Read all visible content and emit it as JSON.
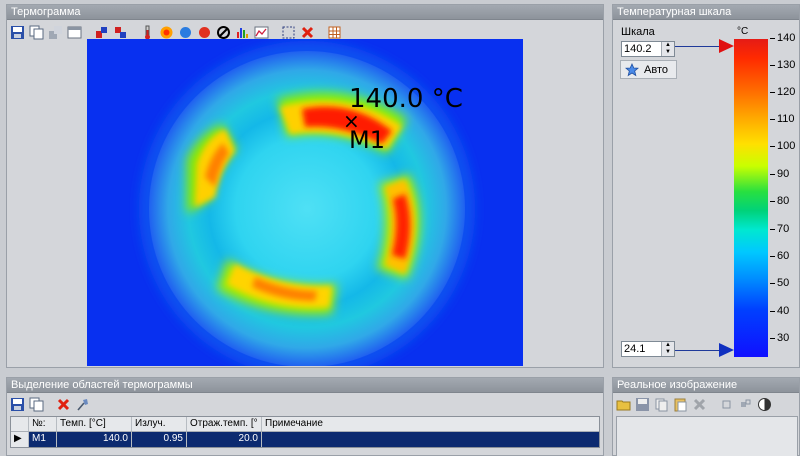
{
  "thermogram": {
    "title": "Термограмма",
    "marker": {
      "symbol": "×",
      "temperature": "140.0 °C",
      "name": "M1"
    }
  },
  "scale": {
    "title": "Температурная шкала",
    "label": "Шкала",
    "max_value": "140.2",
    "min_value": "24.1",
    "auto_label": "Авто",
    "unit": "°C",
    "ticks": [
      "140",
      "130",
      "120",
      "110",
      "100",
      "90",
      "80",
      "70",
      "60",
      "50",
      "40",
      "30"
    ]
  },
  "regions": {
    "title": "Выделение областей термограммы",
    "columns": [
      "",
      "№:",
      "Темп. [°C]",
      "Излуч.",
      "Отраж.темп. [°",
      "Примечание"
    ],
    "rows": [
      {
        "indicator": "▶",
        "id": "M1",
        "temp": "140.0",
        "emissivity": "0.95",
        "refl_temp": "20.0",
        "note": ""
      }
    ]
  },
  "real_image": {
    "title": "Реальное изображение"
  },
  "colors": {
    "view_bg": "#0830f0",
    "selection": "#0c2a70",
    "scale_top": "#e51b16",
    "scale_bottom": "#1010ff"
  }
}
